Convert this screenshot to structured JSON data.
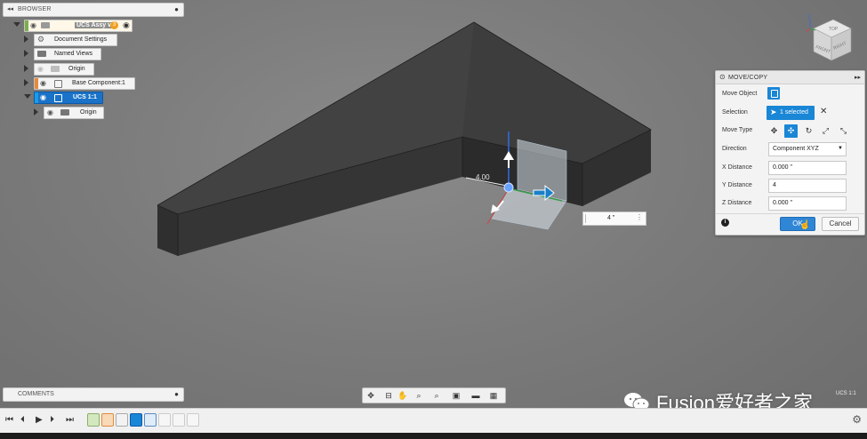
{
  "browser": {
    "header": "BROWSER",
    "nodes": [
      {
        "label": "UCS Assy v6"
      },
      {
        "label": "Document Settings"
      },
      {
        "label": "Named Views"
      },
      {
        "label": "Origin"
      },
      {
        "label": "Base Component:1"
      },
      {
        "label": "UCS 1:1"
      },
      {
        "label": "Origin"
      }
    ],
    "badge": "3"
  },
  "dialog": {
    "title": "MOVE/COPY",
    "rows": {
      "move_object": "Move Object",
      "selection": "Selection",
      "selection_value": "1 selected",
      "move_type": "Move Type",
      "direction": "Direction",
      "direction_value": "Component XYZ",
      "x_distance": "X Distance",
      "x_value": "0.000 \"",
      "y_distance": "Y Distance",
      "y_value": "4",
      "z_distance": "Z Distance",
      "z_value": "0.000 \""
    },
    "ok": "OK",
    "cancel": "Cancel"
  },
  "viewport": {
    "distance_input": "4 \"",
    "dimension_label": "4.00",
    "viewcube": {
      "top": "TOP",
      "front": "FRONT",
      "right": "RIGHT",
      "axis_z": "Z"
    },
    "ucs_label": "UCS 1:1"
  },
  "comments": {
    "header": "COMMENTS"
  },
  "watermark": {
    "text": "Fusion爱好者之家"
  },
  "colors": {
    "accent": "#1a86d6",
    "selected": "#1a73c8",
    "body": "#3b3b3b"
  },
  "icons": {
    "nav": [
      "orbit-icon",
      "look-at-icon",
      "pan-icon",
      "zoom-icon",
      "display-settings-icon",
      "visual-style-icon",
      "grid-icon"
    ],
    "timeline": [
      "rewind-icon",
      "step-back-icon",
      "play-icon",
      "step-forward-icon",
      "fast-forward-icon"
    ]
  }
}
